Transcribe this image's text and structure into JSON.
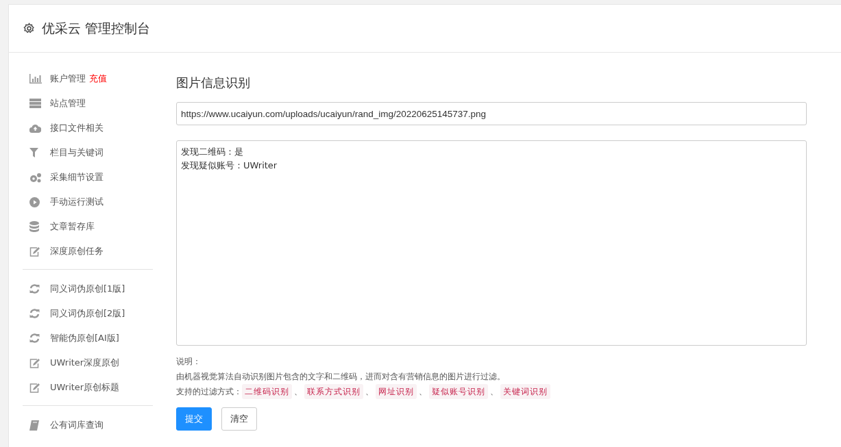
{
  "header": {
    "title": "优采云 管理控制台"
  },
  "sidebar": {
    "groups": [
      {
        "items": [
          {
            "label": "账户管理",
            "badge": "充值"
          },
          {
            "label": "站点管理"
          },
          {
            "label": "接口文件相关"
          },
          {
            "label": "栏目与关键词"
          },
          {
            "label": "采集细节设置"
          },
          {
            "label": "手动运行测试"
          },
          {
            "label": "文章暂存库"
          },
          {
            "label": "深度原创任务"
          }
        ]
      },
      {
        "items": [
          {
            "label": "同义词伪原创[1版]"
          },
          {
            "label": "同义词伪原创[2版]"
          },
          {
            "label": "智能伪原创[AI版]"
          },
          {
            "label": "UWriter深度原创"
          },
          {
            "label": "UWriter原创标题"
          }
        ]
      },
      {
        "items": [
          {
            "label": "公有词库查询"
          }
        ]
      }
    ]
  },
  "main": {
    "title": "图片信息识别",
    "url_field": {
      "value": "https://www.ucaiyun.com/uploads/ucaiyun/rand_img/20220625145737.png"
    },
    "result_box": {
      "lines": [
        "发现二维码：是",
        "发现疑似账号：UWriter"
      ]
    },
    "notes": {
      "heading": "说明：",
      "description": "由机器视觉算法自动识别图片包含的文字和二维码，进而对含有营销信息的图片进行过滤。",
      "methods_label": "支持的过滤方式：",
      "separator": "、",
      "methods": [
        "二维码识别",
        "联系方式识别",
        "网址识别",
        "疑似账号识别",
        "关键词识别"
      ]
    },
    "buttons": [
      {
        "label": "提交",
        "kind": "primary"
      },
      {
        "label": "清空",
        "kind": "default"
      }
    ]
  }
}
